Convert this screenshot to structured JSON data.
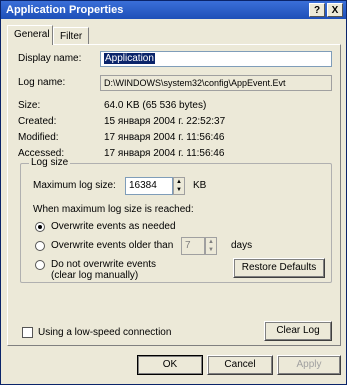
{
  "window": {
    "title": "Application Properties",
    "help_btn": "?",
    "close_btn": "X"
  },
  "tabs": [
    {
      "label": "General",
      "active": true
    },
    {
      "label": "Filter",
      "active": false
    }
  ],
  "general": {
    "display_name_label": "Display name:",
    "display_name_value": "Application",
    "log_name_label": "Log name:",
    "log_name_value": "D:\\WINDOWS\\system32\\config\\AppEvent.Evt",
    "size_label": "Size:",
    "size_value": "64.0 KB (65 536 bytes)",
    "created_label": "Created:",
    "created_value": "15 января 2004 г. 22:52:37",
    "modified_label": "Modified:",
    "modified_value": "17 января 2004 г. 11:56:46",
    "accessed_label": "Accessed:",
    "accessed_value": "17 января 2004 г. 11:56:46"
  },
  "log_size": {
    "group_label": "Log size",
    "max_label": "Maximum log size:",
    "max_value": "16384",
    "max_unit": "KB",
    "when_full_label": "When maximum log size is reached:",
    "options": [
      {
        "label": "Overwrite events as needed",
        "selected": true
      },
      {
        "label": "Overwrite events older than",
        "selected": false
      },
      {
        "label": "Do not overwrite events",
        "sublabel": "(clear log manually)",
        "selected": false
      }
    ],
    "days_value": "7",
    "days_unit": "days",
    "restore_defaults": "Restore Defaults"
  },
  "low_speed": {
    "label": "Using a low-speed connection",
    "checked": false
  },
  "clear_log": "Clear Log",
  "footer": {
    "ok": "OK",
    "cancel": "Cancel",
    "apply": "Apply"
  },
  "colors": {
    "title_bar": "#1e4fb8",
    "selection": "#0a246a",
    "dialog_bg": "#ece9d8"
  }
}
